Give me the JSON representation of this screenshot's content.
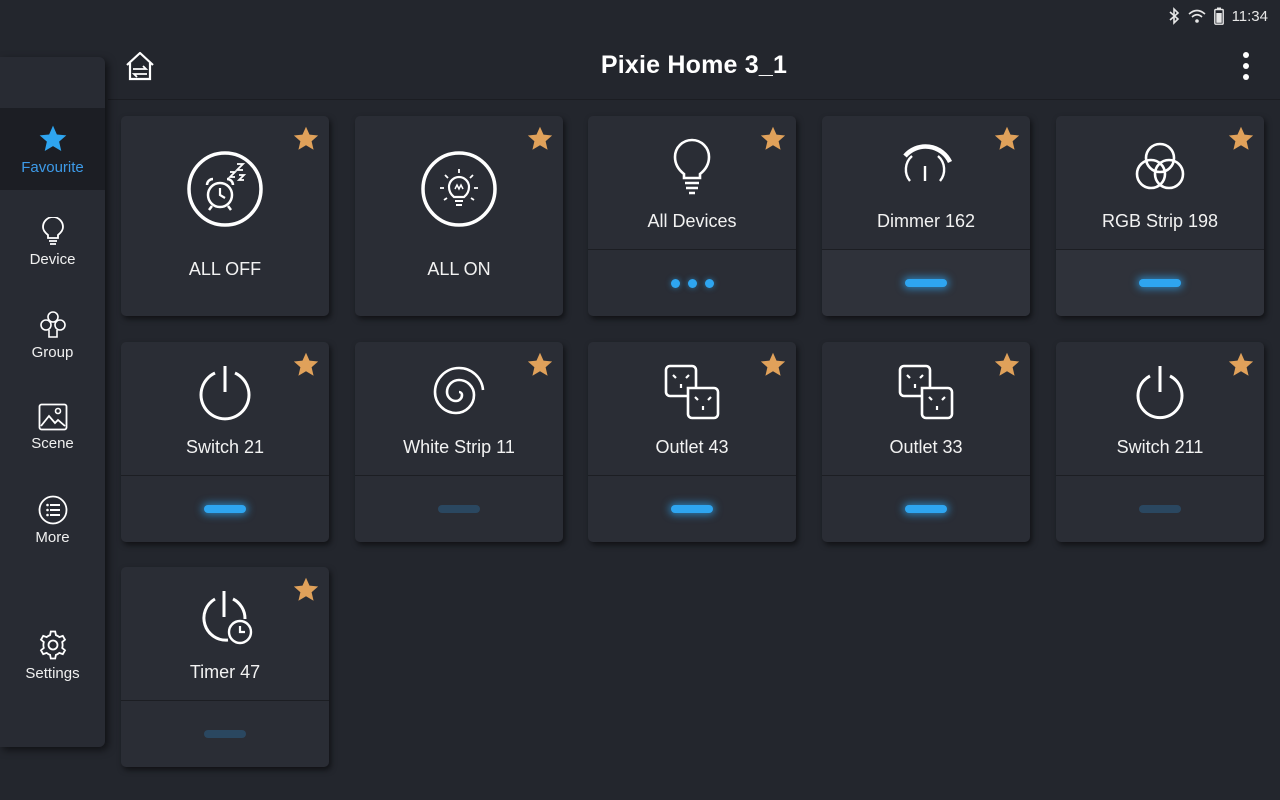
{
  "status_bar": {
    "time": "11:34"
  },
  "header": {
    "title": "Pixie Home 3_1"
  },
  "sidebar": {
    "items": [
      {
        "label": "Favourite"
      },
      {
        "label": "Device"
      },
      {
        "label": "Group"
      },
      {
        "label": "Scene"
      },
      {
        "label": "More"
      },
      {
        "label": "Settings"
      }
    ]
  },
  "cards": [
    {
      "label": "ALL OFF",
      "icon": "alarm-clock-sleep-icon"
    },
    {
      "label": "ALL ON",
      "icon": "lightbulb-on-icon"
    },
    {
      "label": "All Devices",
      "icon": "lightbulb-icon",
      "status": "dots"
    },
    {
      "label": "Dimmer 162",
      "icon": "dimmer-icon",
      "status": "on"
    },
    {
      "label": "RGB Strip 198",
      "icon": "rgb-circles-icon",
      "status": "on"
    },
    {
      "label": "Switch 21",
      "icon": "power-icon",
      "status": "on"
    },
    {
      "label": "White Strip 11",
      "icon": "spiral-strip-icon",
      "status": "off"
    },
    {
      "label": "Outlet 43",
      "icon": "outlet-icon",
      "status": "on"
    },
    {
      "label": "Outlet 33",
      "icon": "outlet-icon",
      "status": "on"
    },
    {
      "label": "Switch 211",
      "icon": "power-icon",
      "status": "off"
    },
    {
      "label": "Timer 47",
      "icon": "power-timer-icon",
      "status": "off"
    }
  ],
  "colors": {
    "accent": "#2ea5f0",
    "favourite_star": "#e0a15a",
    "background": "#23262d",
    "card": "#2a2d35"
  }
}
